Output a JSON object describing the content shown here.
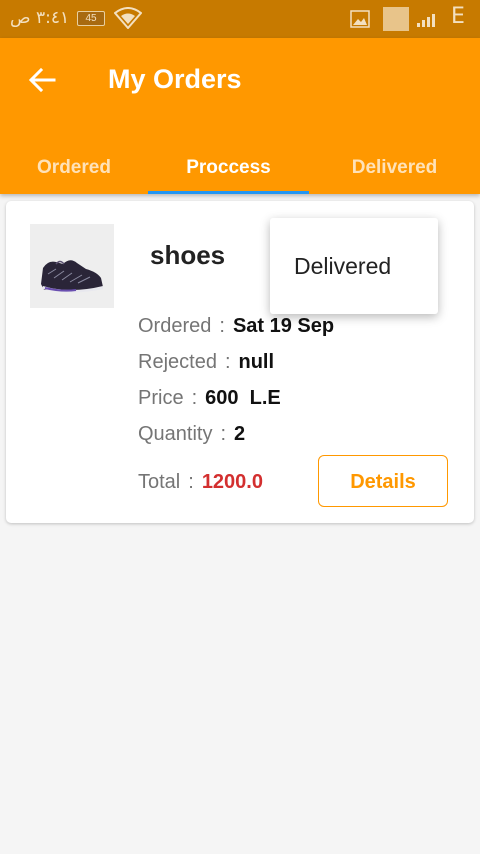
{
  "status_bar": {
    "time": "٣:٤١ ص",
    "battery": "45",
    "network": "E"
  },
  "app_bar": {
    "title": "My Orders",
    "back_icon": "arrow-back-icon"
  },
  "tabs": [
    {
      "label": "Ordered",
      "active": false
    },
    {
      "label": "Proccess",
      "active": true
    },
    {
      "label": "Delivered",
      "active": false
    }
  ],
  "order": {
    "name": "shoes",
    "ordered_label": "Ordered",
    "ordered_value": "Sat 19 Sep",
    "rejected_label": "Rejected",
    "rejected_value": "null",
    "price_label": "Price",
    "price_value": "600  L.E",
    "quantity_label": "Quantity",
    "quantity_value": "2",
    "total_label": "Total",
    "total_value": "1200.0",
    "separator": ":",
    "details_label": "Details"
  },
  "popup": {
    "item": "Delivered"
  },
  "colors": {
    "primary": "#ff9800",
    "status_bar": "#c77a00",
    "tab_indicator": "#2196f3",
    "total": "#d32f2f"
  }
}
